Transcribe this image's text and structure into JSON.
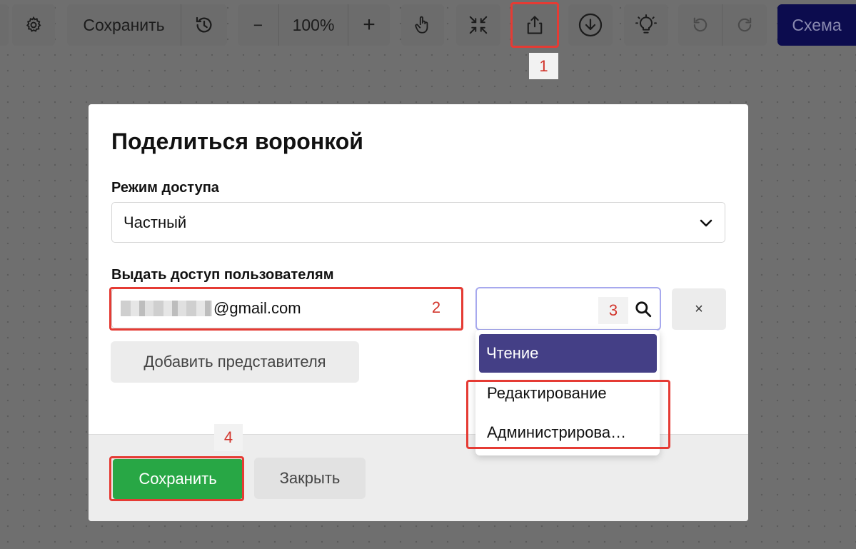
{
  "toolbar": {
    "save_label": "Сохранить",
    "zoom_minus": "−",
    "zoom_value": "100%",
    "zoom_plus": "+",
    "schema_label": "Схема"
  },
  "annotations": {
    "n1": "1",
    "n2": "2",
    "n3": "3",
    "n4": "4",
    "highlight_color": "#e53b34"
  },
  "modal": {
    "title": "Поделиться воронкой",
    "access_mode_label": "Режим доступа",
    "access_mode_value": "Частный",
    "grant_label": "Выдать доступ пользователям",
    "email_suffix": "@gmail.com",
    "search_value": "",
    "remove_label": "×",
    "add_representative": "Добавить представителя",
    "save": "Сохранить",
    "close": "Закрыть"
  },
  "dropdown": {
    "options": [
      "Чтение",
      "Редактирование",
      "Администрирова…"
    ],
    "selected_index": 0
  },
  "colors": {
    "primary": "#443f86",
    "save_green": "#28a745",
    "schema_bg": "#0c0c4e",
    "focus_border": "#a7a9ee"
  },
  "icons": [
    "gear-icon",
    "history-icon",
    "hand-icon",
    "collapse-icon",
    "share-icon",
    "download-icon",
    "lightbulb-icon",
    "undo-icon",
    "redo-icon",
    "chevron-down-icon",
    "search-icon"
  ]
}
